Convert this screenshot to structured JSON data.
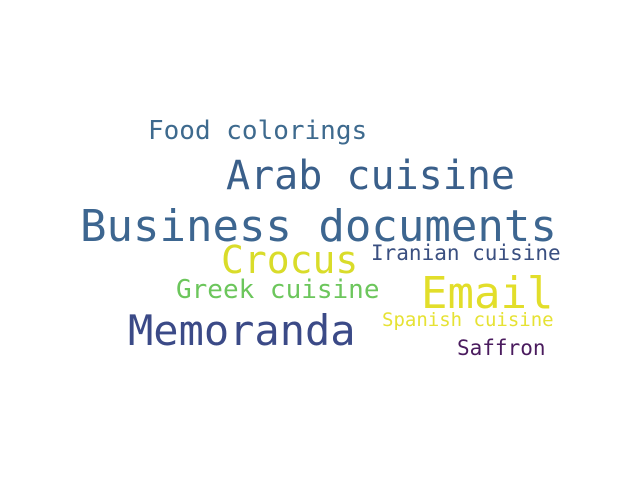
{
  "word_cloud": {
    "words": [
      {
        "text": "Food colorings",
        "color": "#3e6a8e"
      },
      {
        "text": "Arab cuisine",
        "color": "#3a5f8a"
      },
      {
        "text": "Business documents",
        "color": "#3d6690"
      },
      {
        "text": "Crocus",
        "color": "#d9dc2a"
      },
      {
        "text": "Iranian cuisine",
        "color": "#3a4f80"
      },
      {
        "text": "Greek cuisine",
        "color": "#6cc65c"
      },
      {
        "text": "Email",
        "color": "#e2de2a"
      },
      {
        "text": "Memoranda",
        "color": "#3b4a87"
      },
      {
        "text": "Spanish cuisine",
        "color": "#e6e234"
      },
      {
        "text": "Saffron",
        "color": "#4a1b5e"
      }
    ]
  }
}
